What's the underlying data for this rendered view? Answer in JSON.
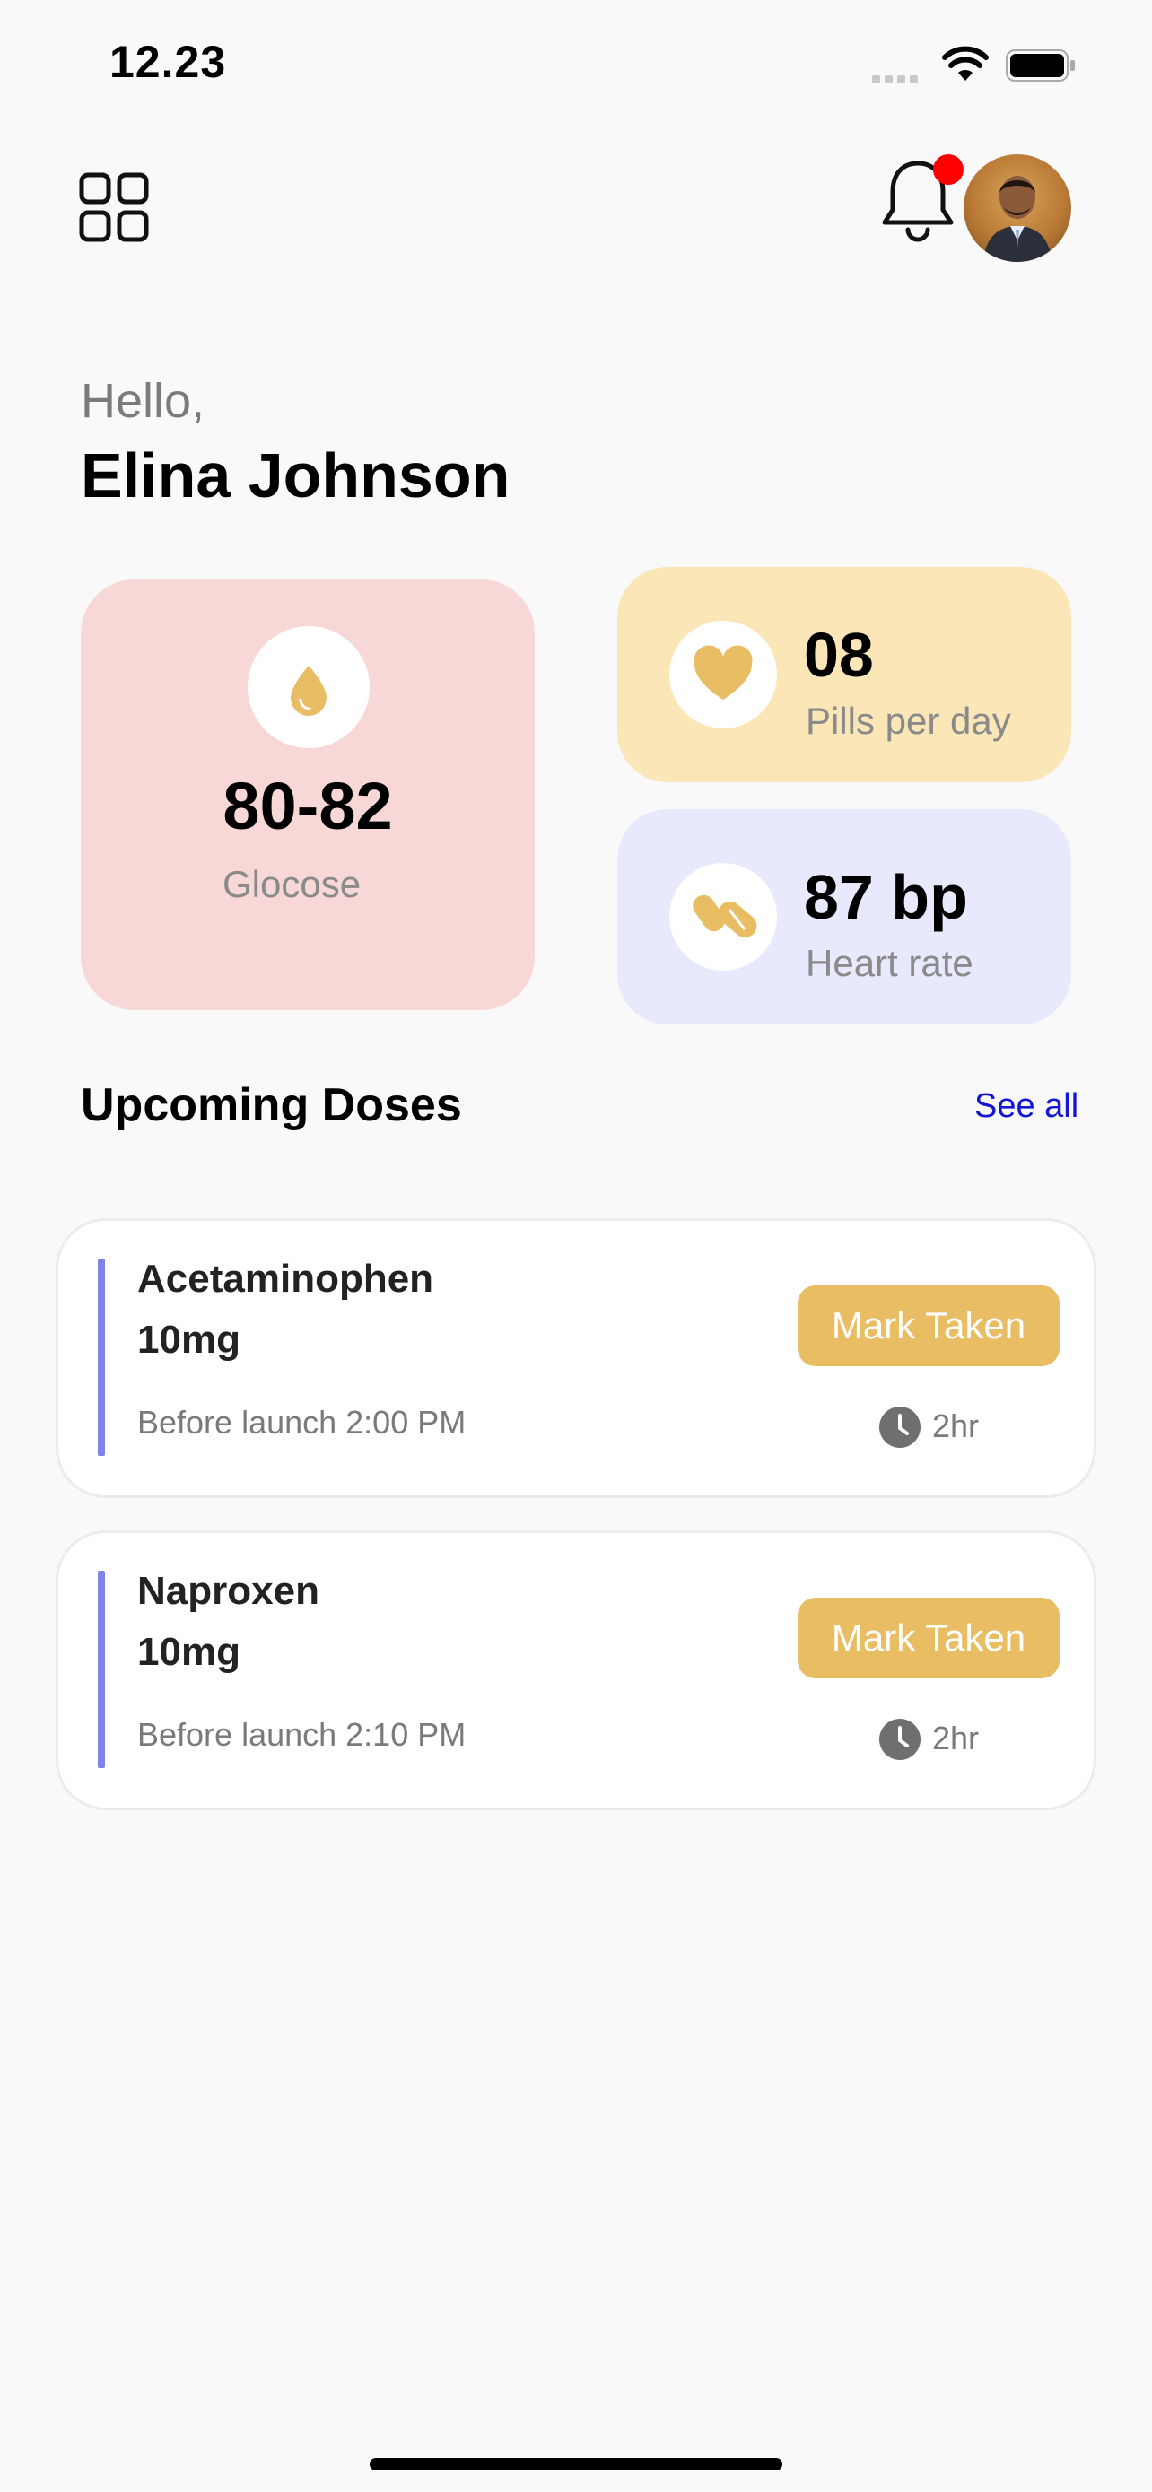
{
  "status_bar": {
    "time": "12.23"
  },
  "header": {
    "greeting": "Hello,",
    "user_name": "Elina Johnson"
  },
  "stats": {
    "glucose": {
      "value": "80-82",
      "label": "Glocose",
      "icon": "droplet-icon",
      "color": "#f7d8d6"
    },
    "pills": {
      "value": "08",
      "label": "Pills per day",
      "icon": "heart-icon",
      "color": "#fae6b6"
    },
    "heart_rate": {
      "value": "87 bp",
      "label": "Heart rate",
      "icon": "pills-icon",
      "color": "#e8e9fd"
    }
  },
  "upcoming": {
    "title": "Upcoming Doses",
    "see_all": "See all",
    "doses": [
      {
        "name": "Acetaminophen",
        "amount": "10mg",
        "schedule": "Before launch 2:00 PM",
        "button": "Mark Taken",
        "time_left": "2hr"
      },
      {
        "name": "Naproxen",
        "amount": "10mg",
        "schedule": "Before launch 2:10 PM",
        "button": "Mark Taken",
        "time_left": "2hr"
      }
    ]
  },
  "colors": {
    "accent": "#e8bd63",
    "link": "#1515d6",
    "dose_bar": "#7f84e8",
    "notification_dot": "#ff0000"
  }
}
